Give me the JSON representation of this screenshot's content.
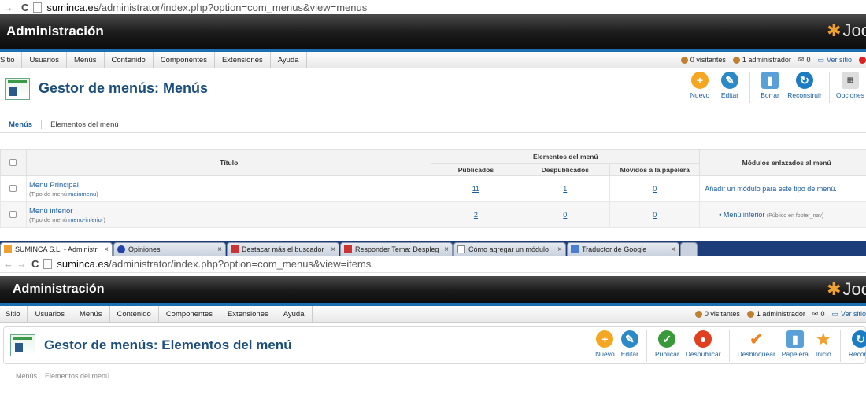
{
  "shot1": {
    "url_domain": "suminca.es",
    "url_path": "/administrator/index.php?option=com_menus&view=menus",
    "admin_title": "Administración",
    "logo_text": "Joo",
    "menu": [
      "Sitio",
      "Usuarios",
      "Menús",
      "Contenido",
      "Componentes",
      "Extensiones",
      "Ayuda"
    ],
    "status": {
      "visitors": "0 visitantes",
      "admins": "1 administrador",
      "messages": "0",
      "view_site": "Ver sitio"
    },
    "page_title": "Gestor de menús: Menús",
    "toolbar": [
      "Nuevo",
      "Editar",
      "Borrar",
      "Reconstruir",
      "Opciones"
    ],
    "subtabs": [
      "Menús",
      "Elementos del menú"
    ],
    "table": {
      "title_header": "Título",
      "group_header": "Elementos del menú",
      "col_published": "Publicados",
      "col_unpublished": "Despublicados",
      "col_trashed": "Movidos a la papelera",
      "col_modules": "Módulos enlazados al menú",
      "rows": [
        {
          "name": "Menu Principal",
          "type_prefix": "(Tipo de menú ",
          "type": "mainmenu",
          "type_suffix": ")",
          "published": "11",
          "unpublished": "1",
          "trashed": "0",
          "module_text": "Añadir un módulo para este tipo de menú."
        },
        {
          "name": "Menú inferior",
          "type_prefix": "(Tipo de menú ",
          "type": "menu-inferior",
          "type_suffix": ")",
          "published": "2",
          "unpublished": "0",
          "trashed": "0",
          "module_text": "Menú inferior",
          "module_note": "(Público en footer_nav)"
        }
      ]
    }
  },
  "shot2": {
    "tabs": [
      {
        "label": "SUMINCA S.L. - Administr",
        "active": true
      },
      {
        "label": "Opiniones",
        "active": false
      },
      {
        "label": "Destacar más el buscador",
        "active": false
      },
      {
        "label": "Responder Tema: Despleg",
        "active": false
      },
      {
        "label": "Cómo agregar un módulo",
        "active": false
      },
      {
        "label": "Traductor de Google",
        "active": false
      }
    ],
    "url_domain": "suminca.es",
    "url_path": "/administrator/index.php?option=com_menus&view=items",
    "admin_title": "Administración",
    "logo_text": "Joo",
    "menu": [
      "Sitio",
      "Usuarios",
      "Menús",
      "Contenido",
      "Componentes",
      "Extensiones",
      "Ayuda"
    ],
    "status": {
      "visitors": "0 visitantes",
      "admins": "1 administrador",
      "messages": "0",
      "view_site": "Ver sitio"
    },
    "page_title": "Gestor de menús: Elementos del menú",
    "toolbar": [
      "Nuevo",
      "Editar",
      "Publicar",
      "Despublicar",
      "Desbloquear",
      "Papelera",
      "Inicio",
      "Reconst"
    ],
    "subtabs": [
      "Menús",
      "Elementos del menú"
    ]
  },
  "colors": {
    "accent": "#1b5c9e",
    "title": "#1c4e7c",
    "strip": "#1b6fb0"
  }
}
